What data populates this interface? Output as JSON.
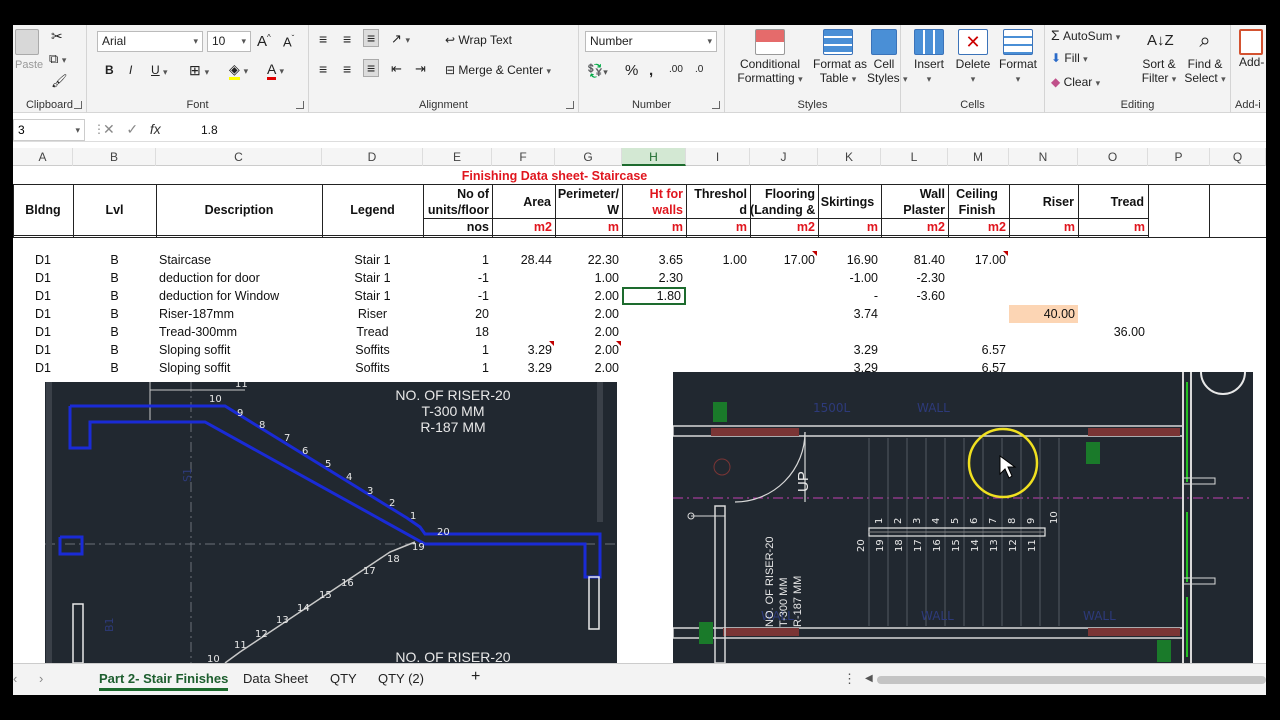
{
  "ribbon": {
    "clipboard": {
      "paste": "Paste",
      "label": "Clipboard"
    },
    "font": {
      "name": "Arial",
      "size": "10",
      "label": "Font",
      "bold": "B",
      "italic": "I",
      "underline": "U"
    },
    "alignment": {
      "wrap": "Wrap Text",
      "merge": "Merge & Center",
      "label": "Alignment"
    },
    "number": {
      "format": "Number",
      "label": "Number"
    },
    "styles": {
      "conditional": "Conditional",
      "conditional2": "Formatting",
      "format_as": "Format as",
      "format_as2": "Table",
      "cell": "Cell",
      "cell2": "Styles",
      "label": "Styles"
    },
    "cells": {
      "insert": "Insert",
      "delete": "Delete",
      "format": "Format",
      "label": "Cells"
    },
    "editing": {
      "autosum": "AutoSum",
      "fill": "Fill",
      "clear": "Clear",
      "sort": "Sort &",
      "sort2": "Filter",
      "find": "Find &",
      "find2": "Select",
      "label": "Editing"
    },
    "addins": {
      "add": "Add-",
      "label": "Add-i"
    }
  },
  "formula_bar": {
    "namebox": "3",
    "fx": "fx",
    "value": "1.8"
  },
  "columns": [
    "A",
    "B",
    "C",
    "D",
    "E",
    "F",
    "G",
    "H",
    "I",
    "J",
    "K",
    "L",
    "M",
    "N",
    "O",
    "P",
    "Q"
  ],
  "sheet": {
    "title": "Finishing Data sheet- Staircase",
    "headers": {
      "bldng": "Bldng",
      "lvl": "Lvl",
      "desc": "Description",
      "legend": "Legend",
      "units1": "No of",
      "units2": "units/floor",
      "area": "Area",
      "perim1": "Perimeter/",
      "perim2": "W",
      "ht1": "Ht for",
      "ht2": "walls",
      "thresh1": "Threshol",
      "thresh2": "d",
      "floor1": "Flooring",
      "floor2": "(Landing &",
      "skirt": "Skirtings",
      "wall1": "Wall",
      "wall2": "Plaster",
      "ceil1": "Ceiling",
      "ceil2": "Finish",
      "riser": "Riser",
      "tread": "Tread"
    },
    "units": {
      "e": "nos",
      "f": "m2",
      "g": "m",
      "h": "m",
      "i": "m",
      "j": "m2",
      "k": "m",
      "l": "m2",
      "m": "m2",
      "n": "m",
      "o": "m"
    },
    "rows": [
      {
        "a": "D1",
        "b": "B",
        "c": "Staircase",
        "d": "Stair 1",
        "e": "1",
        "f": "28.44",
        "g": "22.30",
        "h": "3.65",
        "i": "1.00",
        "j": "17.00",
        "k": "16.90",
        "l": "81.40",
        "m": "17.00",
        "n": "",
        "o": ""
      },
      {
        "a": "D1",
        "b": "B",
        "c": "deduction for door",
        "d": "Stair 1",
        "e": "-1",
        "f": "",
        "g": "1.00",
        "h": "2.30",
        "i": "",
        "j": "",
        "k": "-1.00",
        "l": "-2.30",
        "m": "",
        "n": "",
        "o": ""
      },
      {
        "a": "D1",
        "b": "B",
        "c": "deduction for Window",
        "d": "Stair 1",
        "e": "-1",
        "f": "",
        "g": "2.00",
        "h": "1.80",
        "i": "",
        "j": "",
        "k": "-",
        "l": "-3.60",
        "m": "",
        "n": "",
        "o": ""
      },
      {
        "a": "D1",
        "b": "B",
        "c": "Riser-187mm",
        "d": "Riser",
        "e": "20",
        "f": "",
        "g": "2.00",
        "h": "",
        "i": "",
        "j": "",
        "k": "3.74",
        "l": "",
        "m": "",
        "n": "40.00",
        "o": ""
      },
      {
        "a": "D1",
        "b": "B",
        "c": "Tread-300mm",
        "d": "Tread",
        "e": "18",
        "f": "",
        "g": "2.00",
        "h": "",
        "i": "",
        "j": "",
        "k": "",
        "l": "",
        "m": "",
        "n": "",
        "o": "36.00"
      },
      {
        "a": "D1",
        "b": "B",
        "c": "Sloping soffit",
        "d": "Soffits",
        "e": "1",
        "f": "3.29",
        "g": "2.00",
        "h": "",
        "i": "",
        "j": "",
        "k": "3.29",
        "l": "",
        "m": "6.57",
        "n": "",
        "o": ""
      },
      {
        "a": "D1",
        "b": "B",
        "c": "Sloping soffit",
        "d": "Soffits",
        "e": "1",
        "f": "3.29",
        "g": "2.00",
        "h": "",
        "i": "",
        "j": "",
        "k": "3.29",
        "l": "",
        "m": "6.57",
        "n": "",
        "o": ""
      }
    ]
  },
  "drawing_left": {
    "note1": "NO. OF RISER-20",
    "note2": "T-300 MM",
    "note3": "R-187 MM",
    "note_bottom": "NO. OF RISER-20",
    "steps_upper": [
      "11",
      "10",
      "9",
      "8",
      "7",
      "6",
      "5",
      "4",
      "3",
      "2",
      "1"
    ],
    "steps_lower": [
      "20",
      "19",
      "18",
      "17",
      "16",
      "15",
      "14",
      "13",
      "12",
      "11",
      "10"
    ]
  },
  "drawing_right": {
    "up": "UP",
    "note1": "NO. OF RISER-20",
    "note2": "T-300 MM",
    "note3": "R-187 MM",
    "steps_top": [
      "1",
      "2",
      "3",
      "4",
      "5",
      "6",
      "7",
      "8",
      "9",
      "10"
    ],
    "steps_bottom": [
      "20",
      "19",
      "18",
      "17",
      "16",
      "15",
      "14",
      "13",
      "12",
      "11"
    ]
  },
  "tabs": [
    {
      "label": "Part 2- Stair Finishes",
      "active": true
    },
    {
      "label": "Data Sheet",
      "active": false
    },
    {
      "label": "QTY",
      "active": false
    },
    {
      "label": "QTY (2)",
      "active": false
    }
  ],
  "colors": {
    "accent": "#1d6b2e",
    "title_red": "#e0161e",
    "highlight": "#fcd5b4",
    "cad_bg": "#212830",
    "cad_blue": "#1a2bd6"
  }
}
